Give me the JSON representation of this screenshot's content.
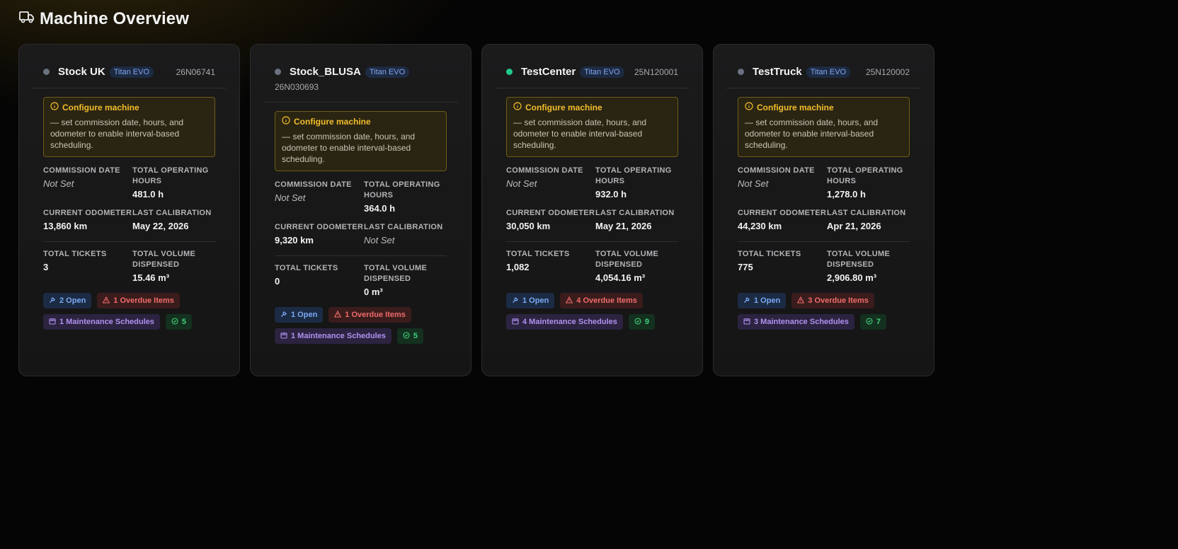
{
  "header": {
    "title": "Machine Overview",
    "icon": "truck-icon"
  },
  "labels": {
    "commission_date": "Commission Date",
    "total_operating_hours": "Total Operating Hours",
    "current_odometer": "Current Odometer",
    "last_calibration": "Last Calibration",
    "total_tickets": "Total Tickets",
    "total_volume_dispensed": "Total Volume Dispensed",
    "config_title": "Configure machine",
    "config_text": "— set commission date, hours, and odometer to enable interval-based scheduling."
  },
  "colors": {
    "accent_warning": "#f2be2c",
    "status_online": "#22c98a",
    "status_offline": "#6c7280"
  },
  "machines": [
    {
      "name": "Stock UK",
      "model": "Titan EVO",
      "serial": "26N06741",
      "status": "offline",
      "commission_date": "Not Set",
      "total_operating_hours": "481.0 h",
      "current_odometer": "13,860 km",
      "last_calibration": "May 22, 2026",
      "total_tickets": "3",
      "total_volume_dispensed": "15.46 m³",
      "badges": {
        "open": "2 Open",
        "overdue": "1 Overdue Items",
        "maintenance": "1 Maintenance Schedules",
        "ok": "5"
      }
    },
    {
      "name": "Stock_BLUSA",
      "model": "Titan EVO",
      "serial": "26N030693",
      "status": "offline",
      "commission_date": "Not Set",
      "total_operating_hours": "364.0 h",
      "current_odometer": "9,320 km",
      "last_calibration": "Not Set",
      "total_tickets": "0",
      "total_volume_dispensed": "0 m³",
      "badges": {
        "open": "1 Open",
        "overdue": "1 Overdue Items",
        "maintenance": "1 Maintenance Schedules",
        "ok": "5"
      }
    },
    {
      "name": "TestCenter",
      "model": "Titan EVO",
      "serial": "25N120001",
      "status": "online",
      "commission_date": "Not Set",
      "total_operating_hours": "932.0 h",
      "current_odometer": "30,050 km",
      "last_calibration": "May 21, 2026",
      "total_tickets": "1,082",
      "total_volume_dispensed": "4,054.16 m³",
      "badges": {
        "open": "1 Open",
        "overdue": "4 Overdue Items",
        "maintenance": "4 Maintenance Schedules",
        "ok": "9"
      }
    },
    {
      "name": "TestTruck",
      "model": "Titan EVO",
      "serial": "25N120002",
      "status": "offline",
      "commission_date": "Not Set",
      "total_operating_hours": "1,278.0 h",
      "current_odometer": "44,230 km",
      "last_calibration": "Apr 21, 2026",
      "total_tickets": "775",
      "total_volume_dispensed": "2,906.80 m³",
      "badges": {
        "open": "1 Open",
        "overdue": "3 Overdue Items",
        "maintenance": "3 Maintenance Schedules",
        "ok": "7"
      }
    }
  ]
}
